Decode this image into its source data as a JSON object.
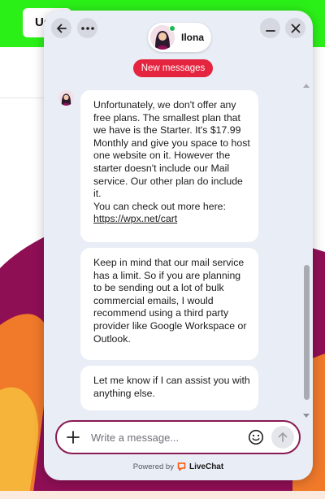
{
  "website": {
    "nav_pill_text": "Us"
  },
  "chat": {
    "agent_name": "Ilona",
    "new_messages_label": "New messages",
    "messages": [
      {
        "text": "Unfortunately, we don't offer any free plans. The smallest plan that we have is the Starter. It's $17.99 Monthly and give you space to host one website on it. However the starter doesn't include our Mail service. Our other plan do include it.\nYou can check out more here:",
        "link": "https://wpx.net/cart"
      },
      {
        "text": "Keep in mind that our mail service has a limit. So if you are planning to be sending out a lot of bulk commercial emails, I would recommend using a third party provider like Google Workspace or Outlook."
      },
      {
        "text": "Let me know if I can assist you with anything else."
      }
    ],
    "composer": {
      "placeholder": "Write a message..."
    },
    "powered_by": "Powered by",
    "brand": "LiveChat"
  },
  "icons": {
    "back": "arrow-left-icon",
    "more": "more-horizontal-icon",
    "minimize": "minimize-icon",
    "close": "close-icon",
    "add": "plus-icon",
    "emoji": "emoji-icon",
    "send": "arrow-up-icon",
    "brand_logo": "livechat-logo-icon"
  },
  "colors": {
    "accent": "#e5243f",
    "composer_border": "#8a1a52",
    "site_green": "#2bf018",
    "site_art_primary": "#8f0f55",
    "site_art_secondary": "#f0792a",
    "widget_bg": "#e9edf6"
  }
}
